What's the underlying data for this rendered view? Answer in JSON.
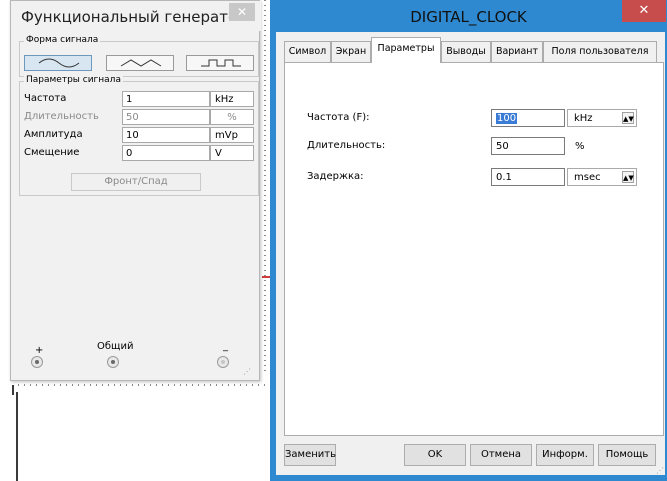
{
  "function_generator": {
    "title": "Функциональный генератор-...",
    "close_glyph": "✕",
    "waveform_group_label": "Форма сигнала",
    "waveforms": [
      "sine",
      "triangle",
      "square"
    ],
    "selected_waveform": "sine",
    "params_group_label": "Параметры сигнала",
    "params": [
      {
        "label": "Частота",
        "value": "1",
        "unit": "kHz",
        "enabled": true
      },
      {
        "label": "Длительность",
        "value": "50",
        "unit": "%",
        "enabled": false
      },
      {
        "label": "Амплитуда",
        "value": "10",
        "unit": "mVp",
        "enabled": true
      },
      {
        "label": "Смещение",
        "value": "0",
        "unit": "V",
        "enabled": true
      }
    ],
    "front_button": "Фронт/Спад",
    "terminals": {
      "plus": "+",
      "common": "Общий",
      "minus": "_"
    }
  },
  "dialog": {
    "title": "DIGITAL_CLOCK",
    "close_glyph": "✕",
    "tabs": [
      "Символ",
      "Экран",
      "Параметры",
      "Выводы",
      "Вариант",
      "Поля пользователя"
    ],
    "active_tab": "Параметры",
    "fields": {
      "frequency": {
        "label": "Частота (F):",
        "value": "100",
        "unit": "kHz"
      },
      "duty": {
        "label": "Длительность:",
        "value": "50",
        "unit": "%"
      },
      "delay": {
        "label": "Задержка:",
        "value": "0.1",
        "unit": "msec"
      }
    },
    "buttons": {
      "replace": "Заменить",
      "ok": "OK",
      "cancel": "Отмена",
      "info": "Информ.",
      "help": "Помощь"
    }
  }
}
